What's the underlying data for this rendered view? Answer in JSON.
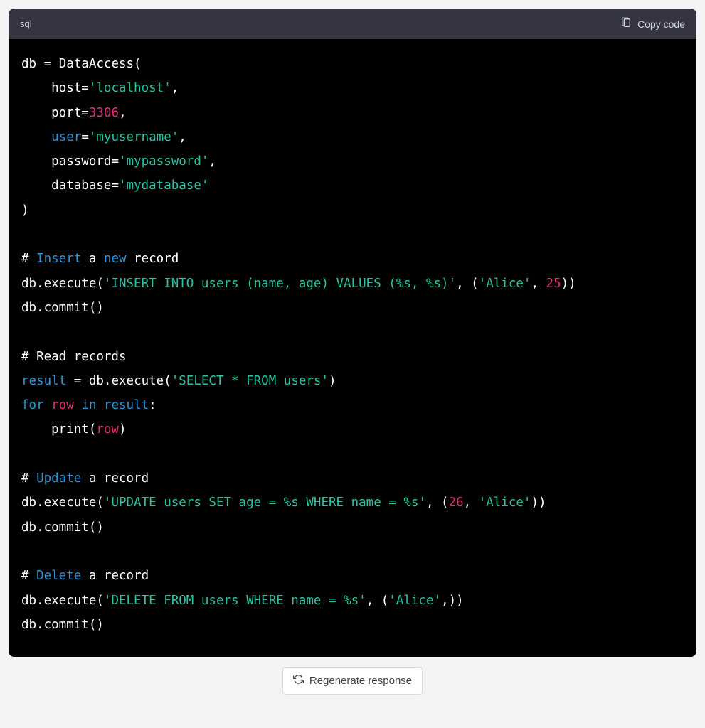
{
  "header": {
    "language_label": "sql",
    "copy_label": "Copy code"
  },
  "code": {
    "lines": [
      {
        "tokens": [
          {
            "t": "db ",
            "c": "w"
          },
          {
            "t": "=",
            "c": "w"
          },
          {
            "t": " DataAccess(",
            "c": "w"
          }
        ]
      },
      {
        "tokens": [
          {
            "t": "    host",
            "c": "w"
          },
          {
            "t": "=",
            "c": "w"
          },
          {
            "t": "'localhost'",
            "c": "str"
          },
          {
            "t": ",",
            "c": "w"
          }
        ]
      },
      {
        "tokens": [
          {
            "t": "    port",
            "c": "w"
          },
          {
            "t": "=",
            "c": "w"
          },
          {
            "t": "3306",
            "c": "num"
          },
          {
            "t": ",",
            "c": "w"
          }
        ]
      },
      {
        "tokens": [
          {
            "t": "    ",
            "c": "w"
          },
          {
            "t": "user",
            "c": "kw"
          },
          {
            "t": "=",
            "c": "w"
          },
          {
            "t": "'myusername'",
            "c": "str"
          },
          {
            "t": ",",
            "c": "w"
          }
        ]
      },
      {
        "tokens": [
          {
            "t": "    password",
            "c": "w"
          },
          {
            "t": "=",
            "c": "w"
          },
          {
            "t": "'mypassword'",
            "c": "str"
          },
          {
            "t": ",",
            "c": "w"
          }
        ]
      },
      {
        "tokens": [
          {
            "t": "    database",
            "c": "w"
          },
          {
            "t": "=",
            "c": "w"
          },
          {
            "t": "'mydatabase'",
            "c": "str"
          }
        ]
      },
      {
        "tokens": [
          {
            "t": ")",
            "c": "w"
          }
        ]
      },
      {
        "tokens": [
          {
            "t": "",
            "c": "w"
          }
        ]
      },
      {
        "tokens": [
          {
            "t": "# ",
            "c": "w"
          },
          {
            "t": "Insert",
            "c": "kw"
          },
          {
            "t": " a ",
            "c": "w"
          },
          {
            "t": "new",
            "c": "kw"
          },
          {
            "t": " record",
            "c": "w"
          }
        ]
      },
      {
        "tokens": [
          {
            "t": "db.execute(",
            "c": "w"
          },
          {
            "t": "'INSERT INTO users (name, age) VALUES (%s, %s)'",
            "c": "str"
          },
          {
            "t": ", (",
            "c": "w"
          },
          {
            "t": "'Alice'",
            "c": "str"
          },
          {
            "t": ", ",
            "c": "w"
          },
          {
            "t": "25",
            "c": "num"
          },
          {
            "t": "))",
            "c": "w"
          }
        ]
      },
      {
        "tokens": [
          {
            "t": "db.commit()",
            "c": "w"
          }
        ]
      },
      {
        "tokens": [
          {
            "t": "",
            "c": "w"
          }
        ]
      },
      {
        "tokens": [
          {
            "t": "# Read records",
            "c": "w"
          }
        ]
      },
      {
        "tokens": [
          {
            "t": "result",
            "c": "kw"
          },
          {
            "t": " ",
            "c": "w"
          },
          {
            "t": "=",
            "c": "w"
          },
          {
            "t": " db.execute(",
            "c": "w"
          },
          {
            "t": "'SELECT * FROM users'",
            "c": "str"
          },
          {
            "t": ")",
            "c": "w"
          }
        ]
      },
      {
        "tokens": [
          {
            "t": "for",
            "c": "kw"
          },
          {
            "t": " ",
            "c": "w"
          },
          {
            "t": "row",
            "c": "var"
          },
          {
            "t": " ",
            "c": "w"
          },
          {
            "t": "in",
            "c": "kw"
          },
          {
            "t": " ",
            "c": "w"
          },
          {
            "t": "result",
            "c": "kw"
          },
          {
            "t": ":",
            "c": "w"
          }
        ]
      },
      {
        "tokens": [
          {
            "t": "    print(",
            "c": "w"
          },
          {
            "t": "row",
            "c": "var"
          },
          {
            "t": ")",
            "c": "w"
          }
        ]
      },
      {
        "tokens": [
          {
            "t": "",
            "c": "w"
          }
        ]
      },
      {
        "tokens": [
          {
            "t": "# ",
            "c": "w"
          },
          {
            "t": "Update",
            "c": "kw"
          },
          {
            "t": " a record",
            "c": "w"
          }
        ]
      },
      {
        "tokens": [
          {
            "t": "db.execute(",
            "c": "w"
          },
          {
            "t": "'UPDATE users SET age = %s WHERE name = %s'",
            "c": "str"
          },
          {
            "t": ", (",
            "c": "w"
          },
          {
            "t": "26",
            "c": "num"
          },
          {
            "t": ", ",
            "c": "w"
          },
          {
            "t": "'Alice'",
            "c": "str"
          },
          {
            "t": "))",
            "c": "w"
          }
        ]
      },
      {
        "tokens": [
          {
            "t": "db.commit()",
            "c": "w"
          }
        ]
      },
      {
        "tokens": [
          {
            "t": "",
            "c": "w"
          }
        ]
      },
      {
        "tokens": [
          {
            "t": "# ",
            "c": "w"
          },
          {
            "t": "Delete",
            "c": "kw"
          },
          {
            "t": " a record",
            "c": "w"
          }
        ]
      },
      {
        "tokens": [
          {
            "t": "db.execute(",
            "c": "w"
          },
          {
            "t": "'DELETE FROM users WHERE name = %s'",
            "c": "str"
          },
          {
            "t": ", (",
            "c": "w"
          },
          {
            "t": "'Alice'",
            "c": "str"
          },
          {
            "t": ",))",
            "c": "w"
          }
        ]
      },
      {
        "tokens": [
          {
            "t": "db.commit()",
            "c": "w"
          }
        ]
      }
    ]
  },
  "footer": {
    "regenerate_label": "Regenerate response"
  }
}
